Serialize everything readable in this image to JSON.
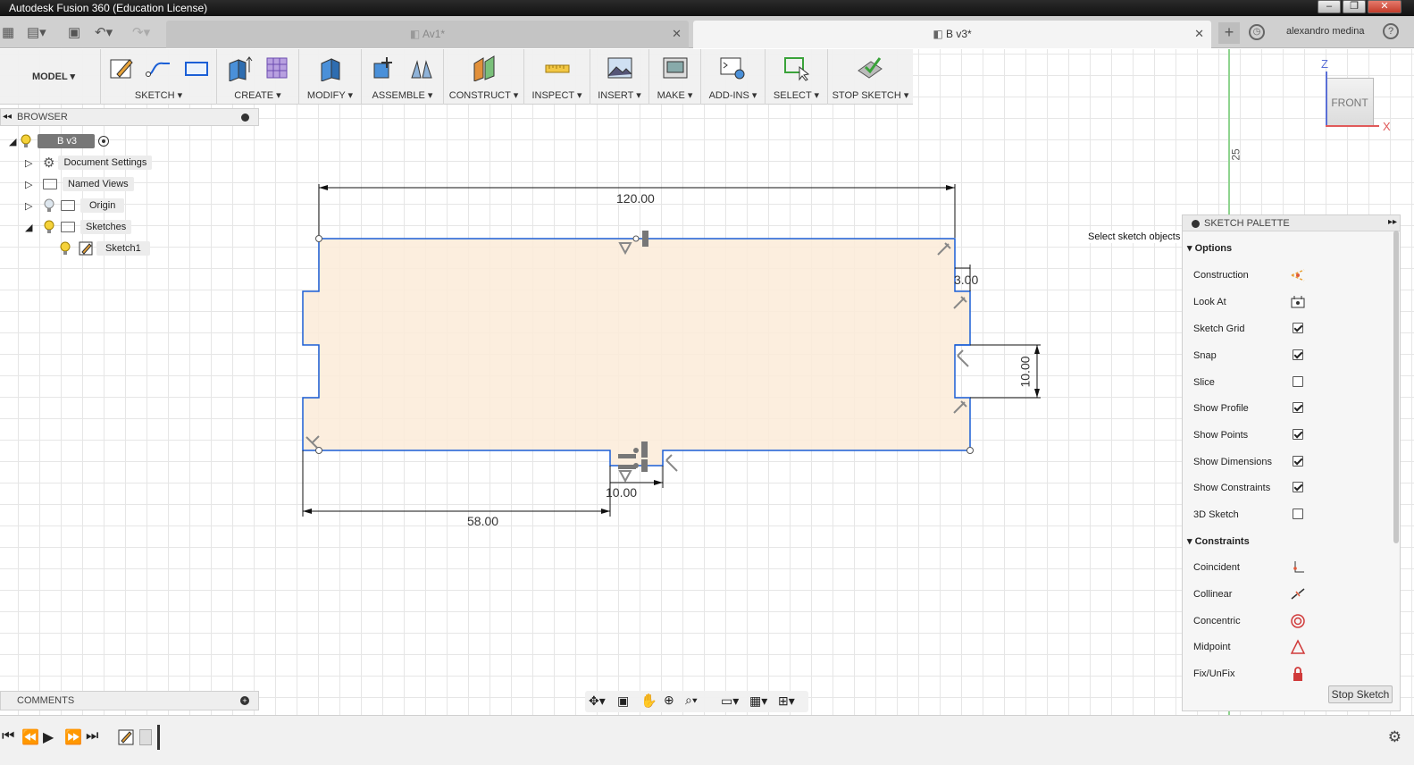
{
  "window": {
    "title": "Autodesk Fusion 360 (Education License)",
    "controls": [
      "–",
      "❐",
      "✕"
    ]
  },
  "tabs": [
    {
      "label": "Av1*",
      "active": false
    },
    {
      "label": "B v3*",
      "active": true
    }
  ],
  "user": {
    "name": "alexandro medina"
  },
  "toolbar": {
    "workspace": "MODEL ▾",
    "groups": [
      "SKETCH ▾",
      "CREATE ▾",
      "MODIFY ▾",
      "ASSEMBLE ▾",
      "CONSTRUCT ▾",
      "INSPECT ▾",
      "INSERT ▾",
      "MAKE ▾",
      "ADD-INS ▾",
      "SELECT ▾",
      "STOP SKETCH ▾"
    ]
  },
  "browser": {
    "title": "BROWSER",
    "root": "B v3",
    "items": [
      "Document Settings",
      "Named Views",
      "Origin",
      "Sketches",
      "Sketch1"
    ]
  },
  "comments": {
    "title": "COMMENTS"
  },
  "sketch": {
    "dimensions": [
      "120.00",
      "3.00",
      "10.00",
      "10.00",
      "58.00"
    ],
    "grid_label": "25"
  },
  "viewcube": {
    "face": "FRONT",
    "axis_z": "Z",
    "axis_x": "X"
  },
  "tooltip": "Select sketch objects to dimension",
  "palette": {
    "title": "SKETCH PALETTE",
    "options_header": "Options",
    "options": [
      {
        "label": "Construction",
        "type": "icon"
      },
      {
        "label": "Look At",
        "type": "icon"
      },
      {
        "label": "Sketch Grid",
        "type": "check",
        "checked": true
      },
      {
        "label": "Snap",
        "type": "check",
        "checked": true
      },
      {
        "label": "Slice",
        "type": "check",
        "checked": false
      },
      {
        "label": "Show Profile",
        "type": "check",
        "checked": true
      },
      {
        "label": "Show Points",
        "type": "check",
        "checked": true
      },
      {
        "label": "Show Dimensions",
        "type": "check",
        "checked": true
      },
      {
        "label": "Show Constraints",
        "type": "check",
        "checked": true
      },
      {
        "label": "3D Sketch",
        "type": "check",
        "checked": false
      }
    ],
    "constraints_header": "Constraints",
    "constraints": [
      "Coincident",
      "Collinear",
      "Concentric",
      "Midpoint",
      "Fix/UnFix"
    ],
    "stop_button": "Stop Sketch"
  },
  "colors": {
    "sketch_line": "#1b5fd6",
    "profile_fill": "#fcebd8",
    "accent": "#e8a33a"
  }
}
